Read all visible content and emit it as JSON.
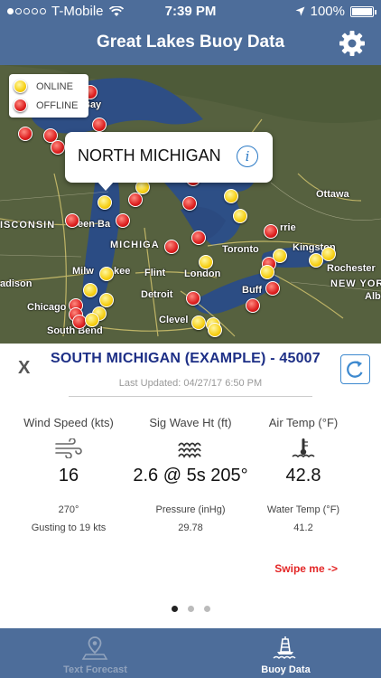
{
  "status_bar": {
    "carrier": "T-Mobile",
    "time": "7:39 PM",
    "battery": "100%",
    "battery_level": 1.0
  },
  "nav": {
    "title": "Great Lakes Buoy Data",
    "settings_icon": "gear-icon"
  },
  "map": {
    "legend": {
      "online": "ONLINE",
      "offline": "OFFLINE"
    },
    "callout": {
      "name": "NORTH MICHIGAN",
      "info_icon": "info-icon"
    },
    "labels": {
      "bay": "Bay",
      "ottawa": "Ottawa",
      "wisconsin": "ISCONSIN",
      "green_bay": "een Ba",
      "michigan": "MICHIGA",
      "errie": "rrie",
      "kingston": "Kingston",
      "toronto": "Toronto",
      "rochester": "Rochester",
      "madison": "adison",
      "milwaukee": "Milw",
      "kee": "kee",
      "flint": "Flint",
      "london": "London",
      "buff": "Buff",
      "new_york": "NEW YOR",
      "alb": "Alb",
      "chicago": "Chicago",
      "detroit": "Detroit",
      "south_bend": "South Bend",
      "cleve": "Clevel"
    },
    "colors": {
      "online": "#f6cf14",
      "offline": "#dd1f1f"
    }
  },
  "buoy": {
    "close_label": "X",
    "station": "SOUTH MICHIGAN (EXAMPLE) - 45007",
    "last_updated": "Last Updated: 04/27/17 6:50 PM",
    "refresh_icon": "refresh-icon",
    "wind": {
      "label": "Wind Speed (kts)",
      "icon": "wind-icon",
      "value": "16",
      "direction": "270°",
      "gust": "Gusting to 19 kts"
    },
    "wave": {
      "label": "Sig Wave Ht (ft)",
      "icon": "wave-icon",
      "value": "2.6 @ 5s 205°",
      "pressure_label": "Pressure (inHg)",
      "pressure": "29.78"
    },
    "air": {
      "label": "Air Temp (°F)",
      "icon": "thermometer-icon",
      "value": "42.8",
      "water_label": "Water Temp (°F)",
      "water": "41.2"
    },
    "swipe_hint": "Swipe me ->",
    "pages": {
      "total": 3,
      "current": 1
    }
  },
  "tabs": [
    {
      "label": "Text Forecast",
      "icon": "location-pin-icon",
      "active": false
    },
    {
      "label": "Buoy Data",
      "icon": "buoy-icon",
      "active": true
    }
  ],
  "theme": {
    "bar": "#4d6d9a",
    "title_blue": "#1d2f86",
    "swipe_red": "#e32626"
  }
}
